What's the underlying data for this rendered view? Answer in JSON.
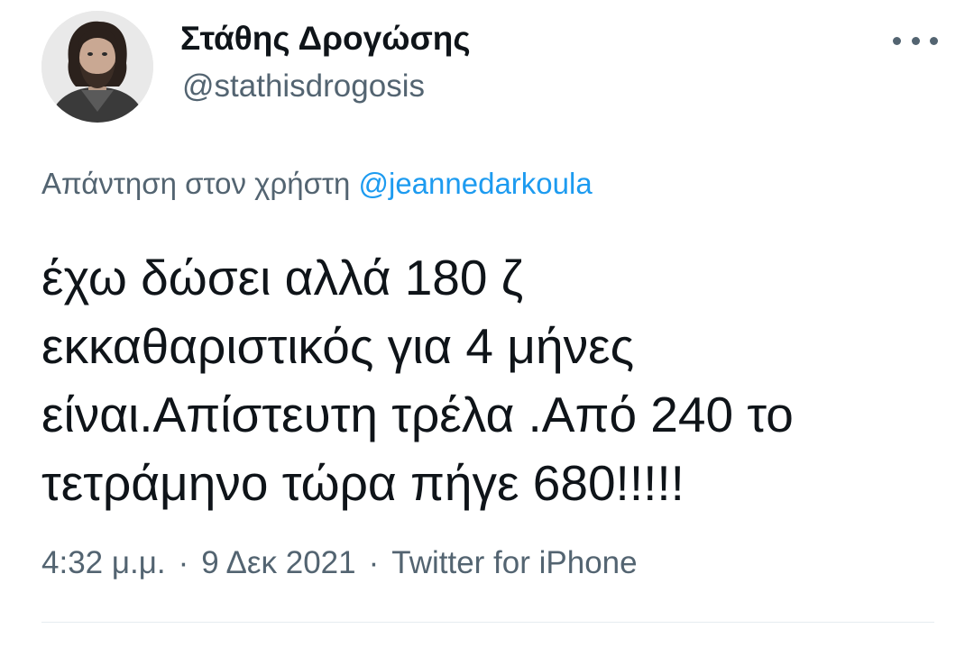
{
  "author": {
    "display_name": "Στάθης Δρογώσης",
    "handle": "@stathisdrogosis",
    "avatar_icon": "user-avatar-photo"
  },
  "more_icon": "more-horizontal-icon",
  "reply": {
    "prefix": "Απάντηση στον χρήστη",
    "mention": "@jeannedarkoula"
  },
  "tweet": {
    "lines": [
      "έχω δώσει αλλά 180 ζ",
      "εκκαθαριστικός για 4 μήνες",
      "είναι.Απίστευτη τρέλα .Από 240 το",
      "τετράμηνο τώρα πήγε 680!!!!!"
    ]
  },
  "meta": {
    "time": "4:32 μ.μ.",
    "separator": "·",
    "date": "9 Δεκ 2021",
    "source": "Twitter for iPhone"
  },
  "colors": {
    "text": "#0f1419",
    "secondary": "#536471",
    "link": "#1d9bf0",
    "divider": "#e6ecf0"
  }
}
